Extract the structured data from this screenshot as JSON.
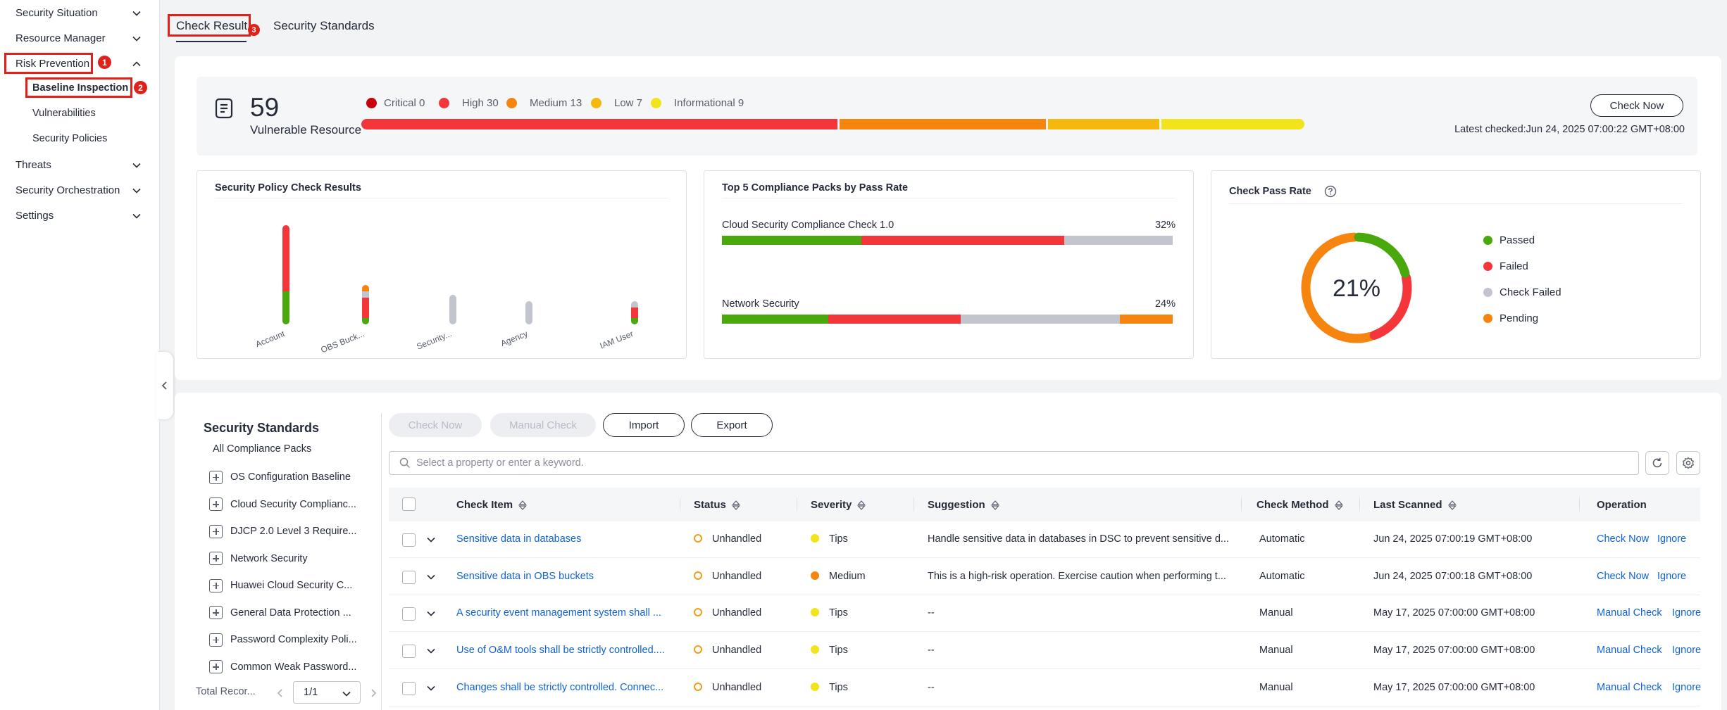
{
  "sidebar": {
    "items": [
      {
        "label": "Security Situation"
      },
      {
        "label": "Resource Manager"
      },
      {
        "label": "Risk Prevention"
      },
      {
        "label": "Threats"
      },
      {
        "label": "Security Orchestration"
      },
      {
        "label": "Settings"
      }
    ],
    "sub_items": [
      {
        "label": "Baseline Inspection"
      },
      {
        "label": "Vulnerabilities"
      },
      {
        "label": "Security Policies"
      }
    ]
  },
  "annotations": [
    "1",
    "2",
    "3"
  ],
  "tabs": [
    {
      "label": "Check Result",
      "active": true
    },
    {
      "label": "Security Standards",
      "active": false
    }
  ],
  "summary": {
    "count": "59",
    "label": "Vulnerable Resource",
    "severities": [
      {
        "label": "Critical 0",
        "color": "#c7000b",
        "value": 0
      },
      {
        "label": "High 30",
        "color": "#f4363b",
        "value": 30
      },
      {
        "label": "Medium 13",
        "color": "#f5850f",
        "value": 13
      },
      {
        "label": "Low 7",
        "color": "#f5b80f",
        "value": 7
      },
      {
        "label": "Informational 9",
        "color": "#f2e41a",
        "value": 9
      }
    ],
    "check_now": "Check Now",
    "latest_checked": "Latest checked:Jun 24, 2025 07:00:22 GMT+08:00"
  },
  "policy_card": {
    "title": "Security Policy Check Results",
    "bars": [
      {
        "label": "Account",
        "passed": 10,
        "failed": 20,
        "check_failed": 0,
        "pending": 0
      },
      {
        "label": "OBS Buck...",
        "passed": 2,
        "failed": 6,
        "check_failed": 2,
        "pending": 2
      },
      {
        "label": "Security...",
        "passed": 0,
        "failed": 0,
        "check_failed": 9,
        "pending": 0
      },
      {
        "label": "Agency",
        "passed": 0,
        "failed": 0,
        "check_failed": 7,
        "pending": 0
      },
      {
        "label": "IAM User",
        "passed": 2,
        "failed": 3,
        "check_failed": 2,
        "pending": 0
      }
    ]
  },
  "packs_card": {
    "title": "Top 5 Compliance Packs by Pass Rate",
    "packs": [
      {
        "name": "Cloud Security Compliance Check 1.0",
        "pct": "32%",
        "passed": 31,
        "failed": 45,
        "check_failed": 24,
        "pending": 0
      },
      {
        "name": "Network Security",
        "pct": "24%",
        "passed": 24,
        "failed": 30,
        "check_failed": 36,
        "pending": 12
      }
    ]
  },
  "rate_card": {
    "title": "Check Pass Rate",
    "help_icon": "help-circle-icon",
    "center": "21%",
    "legend": [
      {
        "label": "Passed",
        "color": "#49a80b"
      },
      {
        "label": "Failed",
        "color": "#f4363b"
      },
      {
        "label": "Check Failed",
        "color": "#c2c5cd"
      },
      {
        "label": "Pending",
        "color": "#f5850f"
      }
    ],
    "segments": [
      {
        "key": "Passed",
        "value": 21,
        "color": "#49a80b"
      },
      {
        "key": "Failed",
        "value": 24,
        "color": "#f4363b"
      },
      {
        "key": "Check Failed",
        "value": 0,
        "color": "#c2c5cd"
      },
      {
        "key": "Pending",
        "value": 55,
        "color": "#f5850f"
      }
    ]
  },
  "standards": {
    "title": "Security Standards",
    "all": "All Compliance Packs",
    "items": [
      "OS Configuration Baseline",
      "Cloud Security Complianc...",
      "DJCP 2.0 Level 3 Require...",
      "Network Security",
      "Huawei Cloud Security C...",
      "General Data Protection ...",
      "Password Complexity Poli...",
      "Common Weak Password..."
    ],
    "total": "Total Recor...",
    "page": "1/1"
  },
  "toolbar": {
    "check_now": "Check Now",
    "manual_check": "Manual Check",
    "import": "Import",
    "export": "Export",
    "search_placeholder": "Select a property or enter a keyword."
  },
  "table": {
    "headers": [
      "Check Item",
      "Status",
      "Severity",
      "Suggestion",
      "Check Method",
      "Last Scanned",
      "Operation"
    ],
    "rows": [
      {
        "item": "Sensitive data in databases",
        "status": "Unhandled",
        "severity": "Tips",
        "sev_color": "#f2e41a",
        "suggestion": "Handle sensitive data in databases in DSC to prevent sensitive d...",
        "method": "Automatic",
        "scanned": "Jun 24, 2025 07:00:19 GMT+08:00",
        "op1": "Check Now",
        "op2": "Ignore"
      },
      {
        "item": "Sensitive data in OBS buckets",
        "status": "Unhandled",
        "severity": "Medium",
        "sev_color": "#f5850f",
        "suggestion": "This is a high-risk operation. Exercise caution when performing t...",
        "method": "Automatic",
        "scanned": "Jun 24, 2025 07:00:18 GMT+08:00",
        "op1": "Check Now",
        "op2": "Ignore"
      },
      {
        "item": "A security event management system shall ...",
        "status": "Unhandled",
        "severity": "Tips",
        "sev_color": "#f2e41a",
        "suggestion": "--",
        "method": "Manual",
        "scanned": "May 17, 2025 07:00:00 GMT+08:00",
        "op1": "Manual Check",
        "op2": "Ignore"
      },
      {
        "item": "Use of O&M tools shall be strictly controlled....",
        "status": "Unhandled",
        "severity": "Tips",
        "sev_color": "#f2e41a",
        "suggestion": "--",
        "method": "Manual",
        "scanned": "May 17, 2025 07:00:00 GMT+08:00",
        "op1": "Manual Check",
        "op2": "Ignore"
      },
      {
        "item": "Changes shall be strictly controlled. Connec...",
        "status": "Unhandled",
        "severity": "Tips",
        "sev_color": "#f2e41a",
        "suggestion": "--",
        "method": "Manual",
        "scanned": "May 17, 2025 07:00:00 GMT+08:00",
        "op1": "Manual Check",
        "op2": "Ignore"
      }
    ]
  },
  "colors": {
    "passed": "#49a80b",
    "failed": "#f4363b",
    "check_failed": "#c2c5cd",
    "pending": "#f5850f",
    "link": "#0f62d6",
    "annotation": "#e0201b"
  }
}
